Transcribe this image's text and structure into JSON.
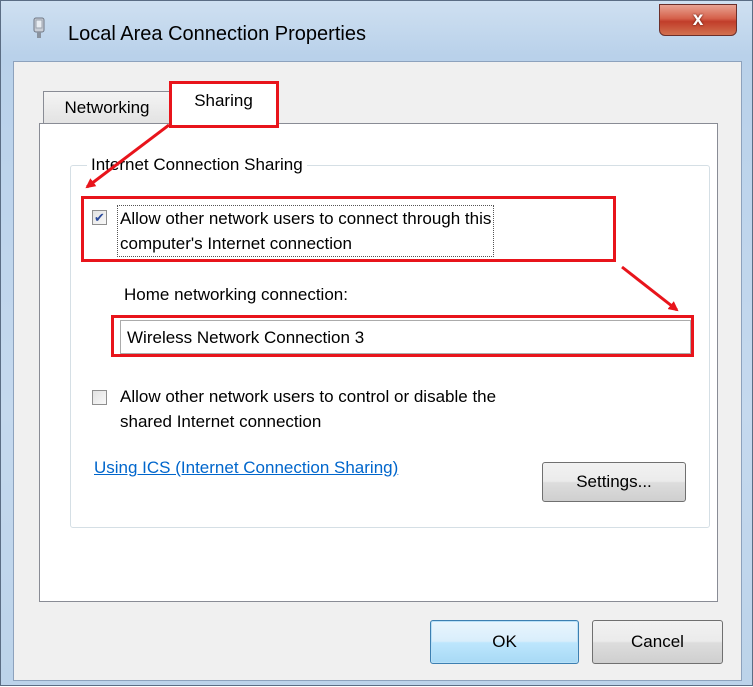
{
  "window": {
    "title": "Local Area Connection Properties",
    "close_label": "x"
  },
  "tabs": [
    {
      "label": "Networking",
      "selected": false
    },
    {
      "label": "Sharing",
      "selected": true
    }
  ],
  "ics": {
    "group_label": "Internet Connection Sharing",
    "allow_connect": {
      "checked": true,
      "line1": "Allow other network users to connect through this",
      "line2": "computer's Internet connection"
    },
    "home_label": "Home networking connection:",
    "home_value": "Wireless Network Connection 3",
    "allow_control": {
      "checked": false,
      "line1": "Allow other network users to control or disable the",
      "line2": "shared Internet connection"
    },
    "help_link": "Using ICS (Internet Connection Sharing)",
    "settings_label": "Settings..."
  },
  "footer": {
    "ok_label": "OK",
    "cancel_label": "Cancel"
  },
  "colors": {
    "annotation": "#e8141b",
    "link": "#0066cc"
  }
}
